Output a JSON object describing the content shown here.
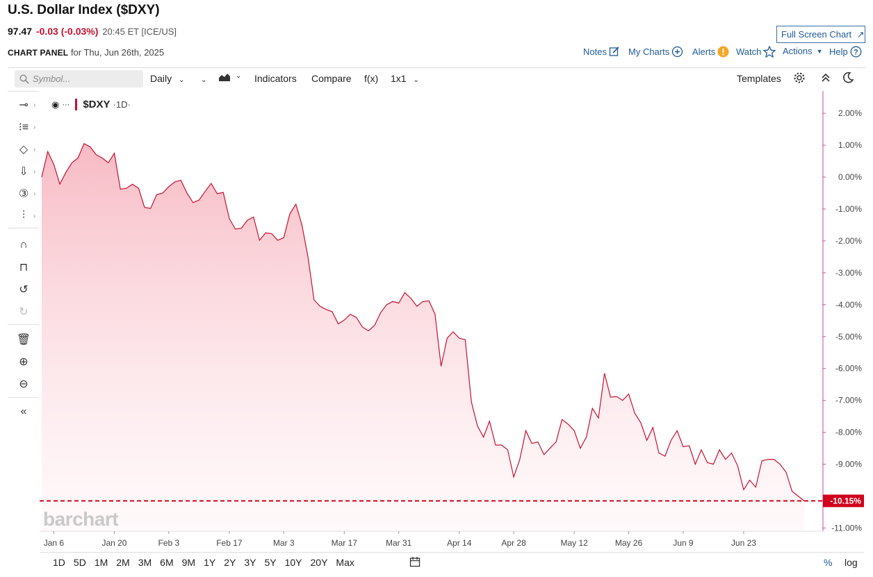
{
  "header": {
    "title": "U.S. Dollar Index ($DXY)",
    "last": "97.47",
    "change": "-0.03 (-0.03%)",
    "time": "20:45 ET [ICE/US]",
    "panel_label": "CHART PANEL",
    "panel_date": "for Thu, Jun 26th, 2025",
    "fullscreen": "Full Screen Chart"
  },
  "links": {
    "notes": "Notes",
    "mycharts": "My Charts",
    "alerts": "Alerts",
    "watch": "Watch",
    "actions": "Actions",
    "help": "Help"
  },
  "toolbar": {
    "search_placeholder": "Symbol...",
    "interval": "Daily",
    "indicators": "Indicators",
    "compare": "Compare",
    "fx": "f(x)",
    "layout": "1x1",
    "templates": "Templates"
  },
  "legend": {
    "symbol": "$DXY",
    "interval": "·1D·"
  },
  "logo": "barchart",
  "ranges": [
    "1D",
    "5D",
    "1M",
    "2M",
    "3M",
    "6M",
    "9M",
    "1Y",
    "2Y",
    "3Y",
    "5Y",
    "10Y",
    "20Y",
    "Max"
  ],
  "scale_options": {
    "percent": "%",
    "log": "log"
  },
  "colors": {
    "line": "#c8102e",
    "accent": "#1f5a96"
  },
  "chart_data": {
    "type": "area",
    "series": [
      {
        "values": [
          0.0,
          0.8,
          0.4,
          -0.22,
          0.15,
          0.45,
          0.6,
          1.05,
          0.95,
          0.7,
          0.6,
          0.45,
          0.75,
          -0.38,
          -0.35,
          -0.22,
          -0.35,
          -0.95,
          -0.98,
          -0.55,
          -0.5,
          -0.3,
          -0.15,
          -0.1,
          -0.5,
          -0.8,
          -0.72,
          -0.45,
          -0.2,
          -0.52,
          -0.48,
          -1.3,
          -1.63,
          -1.6,
          -1.35,
          -1.25,
          -1.98,
          -1.75,
          -1.77,
          -1.98,
          -1.9,
          -1.15,
          -0.85,
          -1.5,
          -2.5,
          -3.85,
          -4.05,
          -4.15,
          -4.22,
          -4.6,
          -4.48,
          -4.3,
          -4.4,
          -4.7,
          -4.82,
          -4.65,
          -4.25,
          -4.0,
          -3.9,
          -3.95,
          -3.62,
          -3.8,
          -4.05,
          -3.9,
          -3.88,
          -4.3,
          -5.93,
          -5.05,
          -4.85,
          -5.05,
          -5.1,
          -7.05,
          -7.8,
          -8.15,
          -7.65,
          -8.4,
          -8.4,
          -8.55,
          -9.4,
          -8.85,
          -7.95,
          -8.35,
          -8.3,
          -8.7,
          -8.5,
          -8.3,
          -7.6,
          -7.75,
          -7.95,
          -8.5,
          -8.15,
          -7.25,
          -7.55,
          -6.15,
          -6.9,
          -6.88,
          -7.0,
          -6.8,
          -7.4,
          -7.7,
          -8.25,
          -7.85,
          -8.65,
          -8.75,
          -8.25,
          -7.95,
          -8.45,
          -8.42,
          -9.0,
          -8.55,
          -8.95,
          -9.0,
          -8.55,
          -8.85,
          -8.65,
          -9.05,
          -9.8,
          -9.5,
          -9.72,
          -8.9,
          -8.85,
          -8.85,
          -9.0,
          -9.25,
          -9.85,
          -10.0,
          -10.15
        ]
      }
    ],
    "x_labels": [
      "Jan 6",
      "Jan 20",
      "Feb 3",
      "Feb 17",
      "Mar 3",
      "Mar 17",
      "Mar 31",
      "Apr 14",
      "Apr 28",
      "May 12",
      "May 26",
      "Jun 9",
      "Jun 23"
    ],
    "x_label_index": [
      2,
      12,
      21,
      31,
      40,
      50,
      59,
      69,
      78,
      88,
      97,
      106,
      116
    ],
    "y_ticks": [
      "2.00%",
      "1.00%",
      "0.00%",
      "-1.00%",
      "-2.00%",
      "-3.00%",
      "-4.00%",
      "-5.00%",
      "-6.00%",
      "-7.00%",
      "-8.00%",
      "-9.00%",
      "-10.00%",
      "-11.00%"
    ],
    "y_tick_values": [
      2,
      1,
      0,
      -1,
      -2,
      -3,
      -4,
      -5,
      -6,
      -7,
      -8,
      -9,
      -10,
      -11
    ],
    "ylim": [
      -11.1,
      2.7
    ],
    "last_value": -10.15,
    "last_label": "-10.15%",
    "y_unit": "%"
  }
}
